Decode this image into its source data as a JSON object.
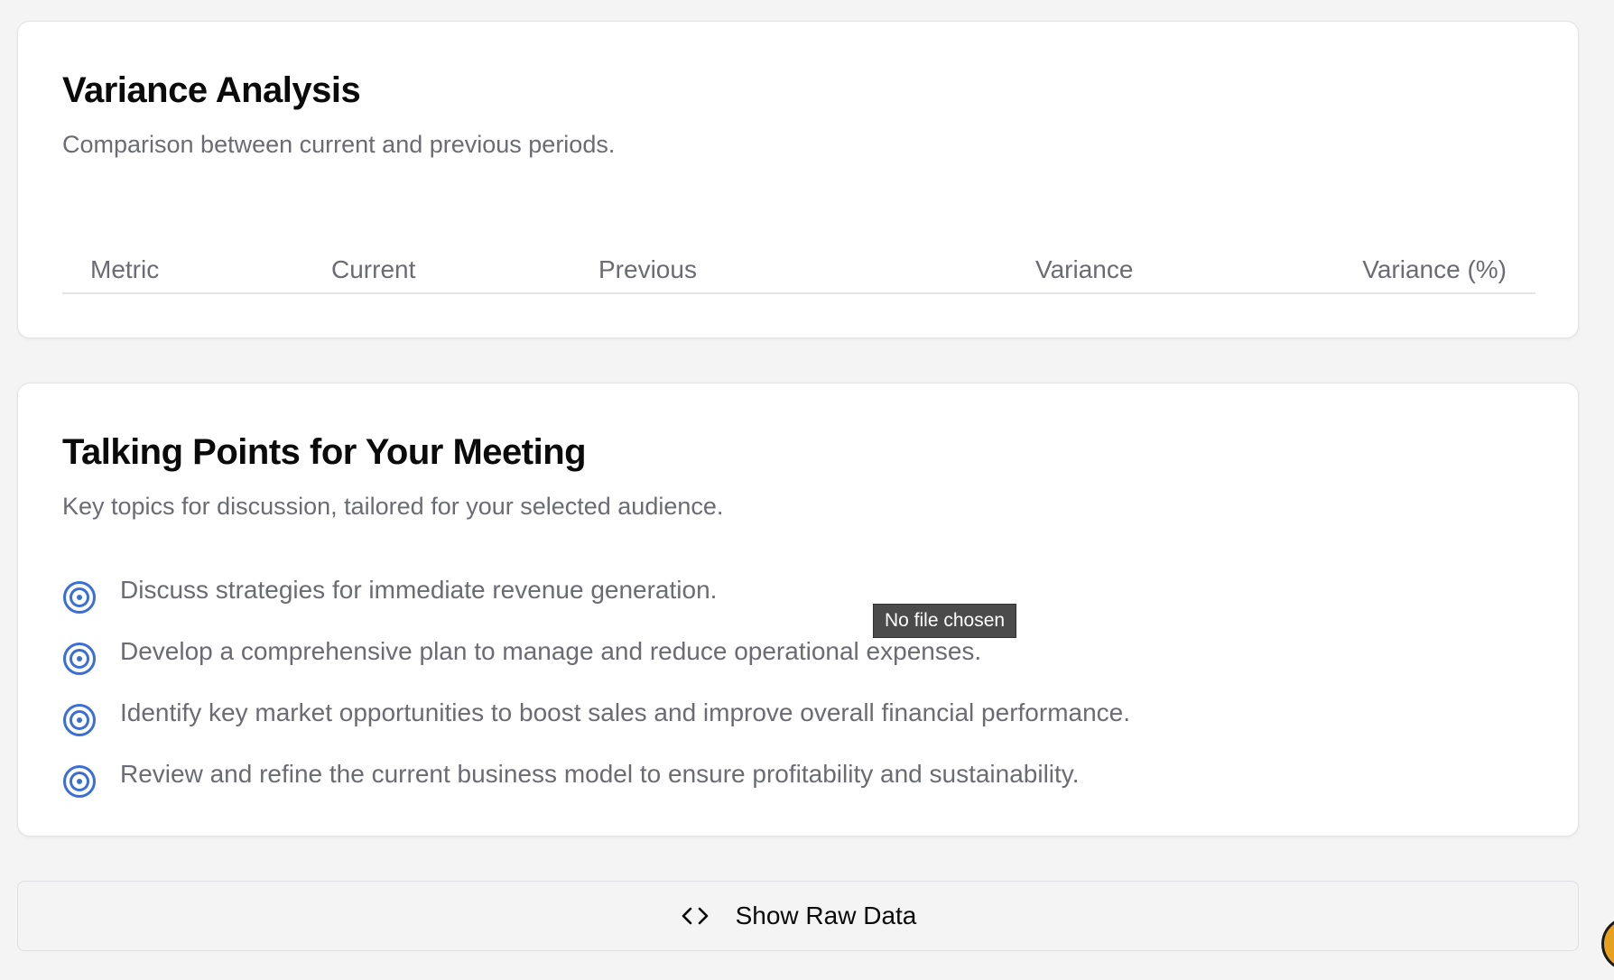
{
  "variance": {
    "title": "Variance Analysis",
    "description": "Comparison between current and previous periods.",
    "columns": [
      "Metric",
      "Current",
      "Previous",
      "Variance",
      "Variance (%)"
    ]
  },
  "talking_points": {
    "title": "Talking Points for Your Meeting",
    "description": "Key topics for discussion, tailored for your selected audience.",
    "icon": "target-icon",
    "icon_color": "#3b6fd6",
    "items": [
      "Discuss strategies for immediate revenue generation.",
      "Develop a comprehensive plan to manage and reduce operational expenses.",
      "Identify key market opportunities to boost sales and improve overall financial performance.",
      "Review and refine the current business model to ensure profitability and sustainability."
    ]
  },
  "tooltip": {
    "text": "No file chosen"
  },
  "raw_data_button": {
    "label": "Show Raw Data",
    "icon": "code-icon"
  }
}
